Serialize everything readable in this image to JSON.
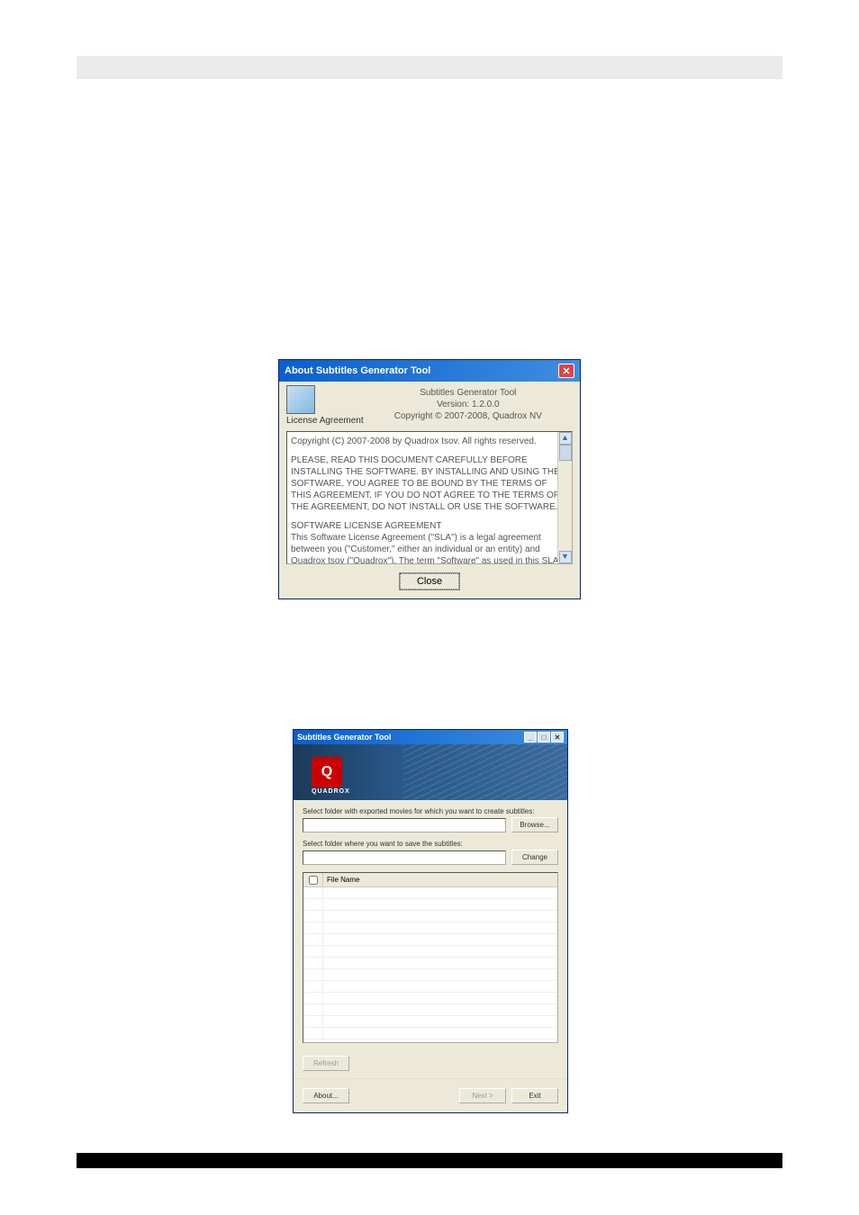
{
  "about": {
    "title": "About Subtitles Generator Tool",
    "app_name": "Subtitles Generator Tool",
    "version": "Version: 1.2.0.0",
    "copyright": "Copyright © 2007-2008, Quadrox NV",
    "license_label": "License Agreement",
    "license_body_1": "Copyright (C) 2007-2008 by Quadrox tsov. All rights reserved.",
    "license_body_2": "PLEASE, READ THIS DOCUMENT CAREFULLY BEFORE INSTALLING THE SOFTWARE. BY INSTALLING AND USING THE SOFTWARE, YOU AGREE TO BE BOUND BY THE TERMS OF THIS AGREEMENT.  IF YOU DO NOT AGREE TO THE TERMS OF THE AGREEMENT, DO NOT INSTALL OR USE THE SOFTWARE.",
    "license_body_3": "SOFTWARE LICENSE AGREEMENT\nThis Software License Agreement (\"SLA\") is a legal agreement between you (\"Customer,\" either an individual or an entity) and Quadrox tsov (\"Quadrox\"). The term \"Software\" as used in this SLA means the computer software contained in the package or file(s) to which this SLA is annexed, the associated media, any printed documentation and materials, and any \"on-line\" or electronic",
    "close_btn": "Close"
  },
  "tool": {
    "title": "Subtitles Generator Tool",
    "brand": "QUADROX",
    "logo_letter": "Q",
    "label_source": "Select folder with exported movies for which you want to create subtitles:",
    "browse_btn": "Browse...",
    "label_dest": "Select folder where you want to save the subtitles:",
    "change_btn": "Change",
    "col_filename": "File Name",
    "refresh_btn": "Refresh",
    "about_btn": "About...",
    "next_btn": "Next >",
    "exit_btn": "Exit"
  }
}
